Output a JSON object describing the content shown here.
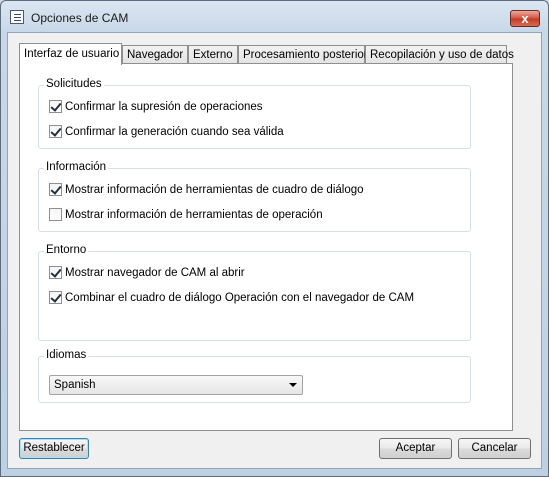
{
  "window": {
    "title": "Opciones de CAM",
    "close_glyph": "x"
  },
  "tabs": [
    {
      "label": "Interfaz de usuario",
      "active": true
    },
    {
      "label": "Navegador"
    },
    {
      "label": "Externo"
    },
    {
      "label": "Procesamiento posterior"
    },
    {
      "label": "Recopilación y uso de datos"
    }
  ],
  "groups": {
    "prompts": {
      "legend": "Solicitudes",
      "items": [
        {
          "label": "Confirmar la supresión de operaciones",
          "checked": true
        },
        {
          "label": "Confirmar la generación cuando sea válida",
          "checked": true
        }
      ]
    },
    "info": {
      "legend": "Información",
      "items": [
        {
          "label": "Mostrar información de herramientas de cuadro de diálogo",
          "checked": true
        },
        {
          "label": "Mostrar información de herramientas de operación",
          "checked": false
        }
      ]
    },
    "environment": {
      "legend": "Entorno",
      "items": [
        {
          "label": "Mostrar navegador de CAM al abrir",
          "checked": true
        },
        {
          "label": "Combinar el cuadro de diálogo Operación con el navegador de CAM",
          "checked": true
        }
      ]
    },
    "languages": {
      "legend": "Idiomas",
      "selected": "Spanish"
    }
  },
  "buttons": {
    "reset": "Restablecer",
    "ok": "Aceptar",
    "cancel": "Cancelar"
  },
  "icons": {
    "app": "dialog-window-icon",
    "close": "close-icon",
    "dropdown": "chevron-down-icon"
  }
}
